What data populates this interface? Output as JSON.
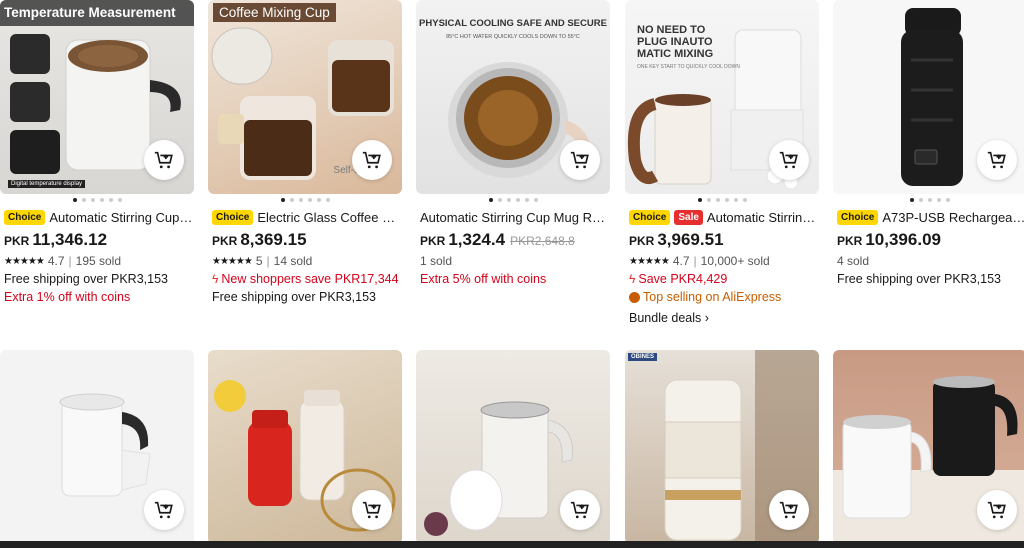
{
  "cards": [
    {
      "image_caption": "Temperature Measurement",
      "image_subcaption": "Digital temperature display",
      "badges": [
        "Choice"
      ],
      "title": "Automatic Stirring Cup R...",
      "currency": "PKR",
      "price": "11,346.12",
      "rating": "4.7",
      "sold": "195 sold",
      "lines": [
        {
          "text": "Free shipping over PKR3,153",
          "style": "dark"
        },
        {
          "text": "Extra 1% off with coins",
          "style": "red"
        }
      ]
    },
    {
      "image_caption": "Coffee Mixing Cup",
      "image_subcaption": "Self-stirring",
      "badges": [
        "Choice"
      ],
      "title": "Electric Glass Coffee Mu...",
      "currency": "PKR",
      "price": "8,369.15",
      "rating": "5",
      "sold": "14 sold",
      "lines": [
        {
          "text": "New shoppers save PKR17,344",
          "style": "red",
          "icon": "bolt"
        },
        {
          "text": "Free shipping over PKR3,153",
          "style": "dark"
        }
      ]
    },
    {
      "image_caption": "PHYSICAL COOLING SAFE AND SECURE",
      "image_subcaption": "85°C HOT WATER QUICKLY COOLS DOWN TO 55°C",
      "badges": [],
      "title": "Automatic Stirring Cup Mug Re...",
      "currency": "PKR",
      "price": "1,324.4",
      "original_price": "PKR2,648.8",
      "sold": "1 sold",
      "lines": [
        {
          "text": "Extra 5% off with coins",
          "style": "red"
        }
      ]
    },
    {
      "image_caption": "NO NEED TO PLUG INAUTO MATIC MIXING",
      "image_subcaption": "ONE KEY START TO QUICKLY COOL DOWN",
      "badges": [
        "Choice",
        "Sale"
      ],
      "title": "Automatic Stirring C...",
      "currency": "PKR",
      "price": "3,969.51",
      "rating": "4.7",
      "sold": "10,000+ sold",
      "lines": [
        {
          "text": "Save PKR4,429",
          "style": "red",
          "icon": "bolt"
        },
        {
          "text": "Top selling on AliExpress",
          "style": "orange",
          "icon": "fire"
        },
        {
          "text": "Bundle deals ›",
          "style": "dark"
        }
      ]
    },
    {
      "image_caption": "",
      "image_subcaption": "",
      "badges": [
        "Choice"
      ],
      "title": "A73P-USB Rechargeable...",
      "currency": "PKR",
      "price": "10,396.09",
      "sold": "4 sold",
      "lines": [
        {
          "text": "Free shipping over PKR3,153",
          "style": "dark"
        }
      ]
    }
  ],
  "row2_badges": [
    "",
    "",
    "",
    "OBINES",
    ""
  ],
  "icons": {
    "cart": "add-to-cart-icon",
    "star": "star-icon",
    "bolt": "lightning-icon",
    "fire": "fire-icon"
  },
  "colors": {
    "choice_badge": "#ffd700",
    "sale_badge": "#e62e2e",
    "promo_red": "#d3031c",
    "top_selling_orange": "#c75d00"
  }
}
